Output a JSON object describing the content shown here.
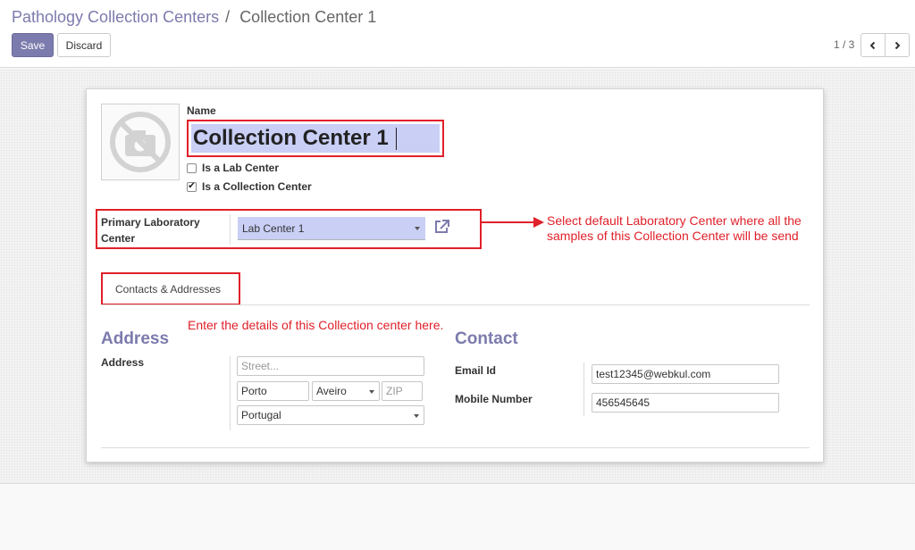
{
  "breadcrumb": {
    "parent": "Pathology Collection Centers",
    "separator": "/",
    "current": "Collection Center 1"
  },
  "toolbar": {
    "save_label": "Save",
    "discard_label": "Discard"
  },
  "pager": {
    "value": "1 / 3"
  },
  "form": {
    "name_label": "Name",
    "name_value": "Collection Center 1",
    "is_lab_center_label": "Is a Lab Center",
    "is_lab_center_checked": false,
    "is_collection_center_label": "Is a Collection Center",
    "is_collection_center_checked": true,
    "primary_lab_label": "Primary Laboratory Center",
    "primary_lab_value": "Lab Center 1",
    "tab_label": "Contacts & Addresses",
    "address_title": "Address",
    "address_label": "Address",
    "street_placeholder": "Street...",
    "city": "Porto",
    "state": "Aveiro",
    "zip_placeholder": "ZIP",
    "country": "Portugal",
    "contact_title": "Contact",
    "email_label": "Email Id",
    "email_value": "test12345@webkul.com",
    "mobile_label": "Mobile Number",
    "mobile_value": "456545645"
  },
  "annotations": {
    "lab_note_line1": "Select default Laboratory Center where all the",
    "lab_note_line2": "samples of this Collection Center will be send",
    "details_note": "Enter the details of this Collection center here."
  },
  "icons": {
    "pager_prev": "chevron-left-icon",
    "pager_next": "chevron-right-icon",
    "external_link": "external-link-icon",
    "avatar": "camera-off-icon"
  },
  "colors": {
    "brand": "#7c7bad",
    "annotation_red": "#e0202a",
    "field_highlight": "#c9cff5"
  }
}
